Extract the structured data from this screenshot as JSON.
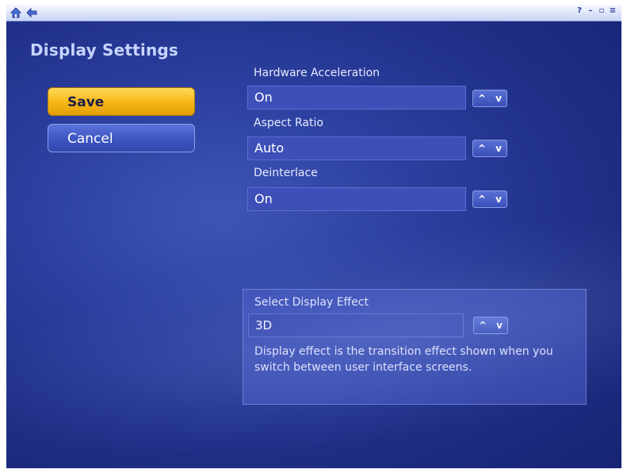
{
  "window": {
    "controls": [
      "?",
      "–",
      "▫",
      "≡"
    ]
  },
  "page": {
    "title": "Display Settings"
  },
  "actions": {
    "save_label": "Save",
    "cancel_label": "Cancel"
  },
  "settings": [
    {
      "label": "Hardware Acceleration",
      "value": "On"
    },
    {
      "label": "Aspect Ratio",
      "value": "Auto"
    },
    {
      "label": "Deinterlace",
      "value": "On"
    }
  ],
  "effect": {
    "label": "Select Display Effect",
    "value": "3D",
    "description": "Display effect is the transition effect shown when you switch between user interface screens."
  },
  "spinner": {
    "up": "^",
    "down": "v"
  },
  "colors": {
    "background": "#2c3f9f",
    "accent": "#f5b615",
    "title": "#c7d4ff"
  },
  "icons": {
    "home": "home-icon",
    "back": "back-arrow-icon"
  }
}
